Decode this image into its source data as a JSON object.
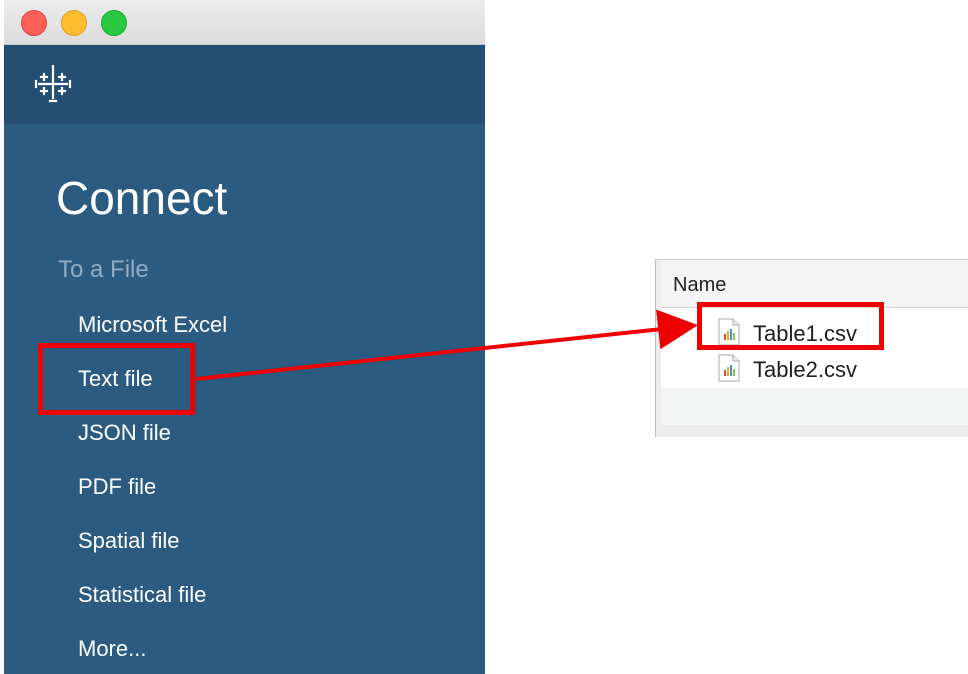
{
  "window": {
    "traffic_lights": [
      "close",
      "minimize",
      "maximize"
    ],
    "logo_icon": "tableau-logo-icon"
  },
  "connect": {
    "title": "Connect",
    "section_heading": "To a File",
    "items": [
      {
        "label": "Microsoft Excel"
      },
      {
        "label": "Text file"
      },
      {
        "label": "JSON file"
      },
      {
        "label": "PDF file"
      },
      {
        "label": "Spatial file"
      },
      {
        "label": "Statistical file"
      },
      {
        "label": "More..."
      }
    ]
  },
  "finder": {
    "column_header": "Name",
    "files": [
      {
        "name": "Table1.csv",
        "icon": "csv-file-icon"
      },
      {
        "name": "Table2.csv",
        "icon": "csv-file-icon"
      }
    ]
  },
  "annotations": {
    "highlight_color": "#ee0000"
  },
  "colors": {
    "sidebar_bg": "#2b5b81",
    "logobar_bg": "#244f72",
    "section_heading": "#8fadc5"
  }
}
